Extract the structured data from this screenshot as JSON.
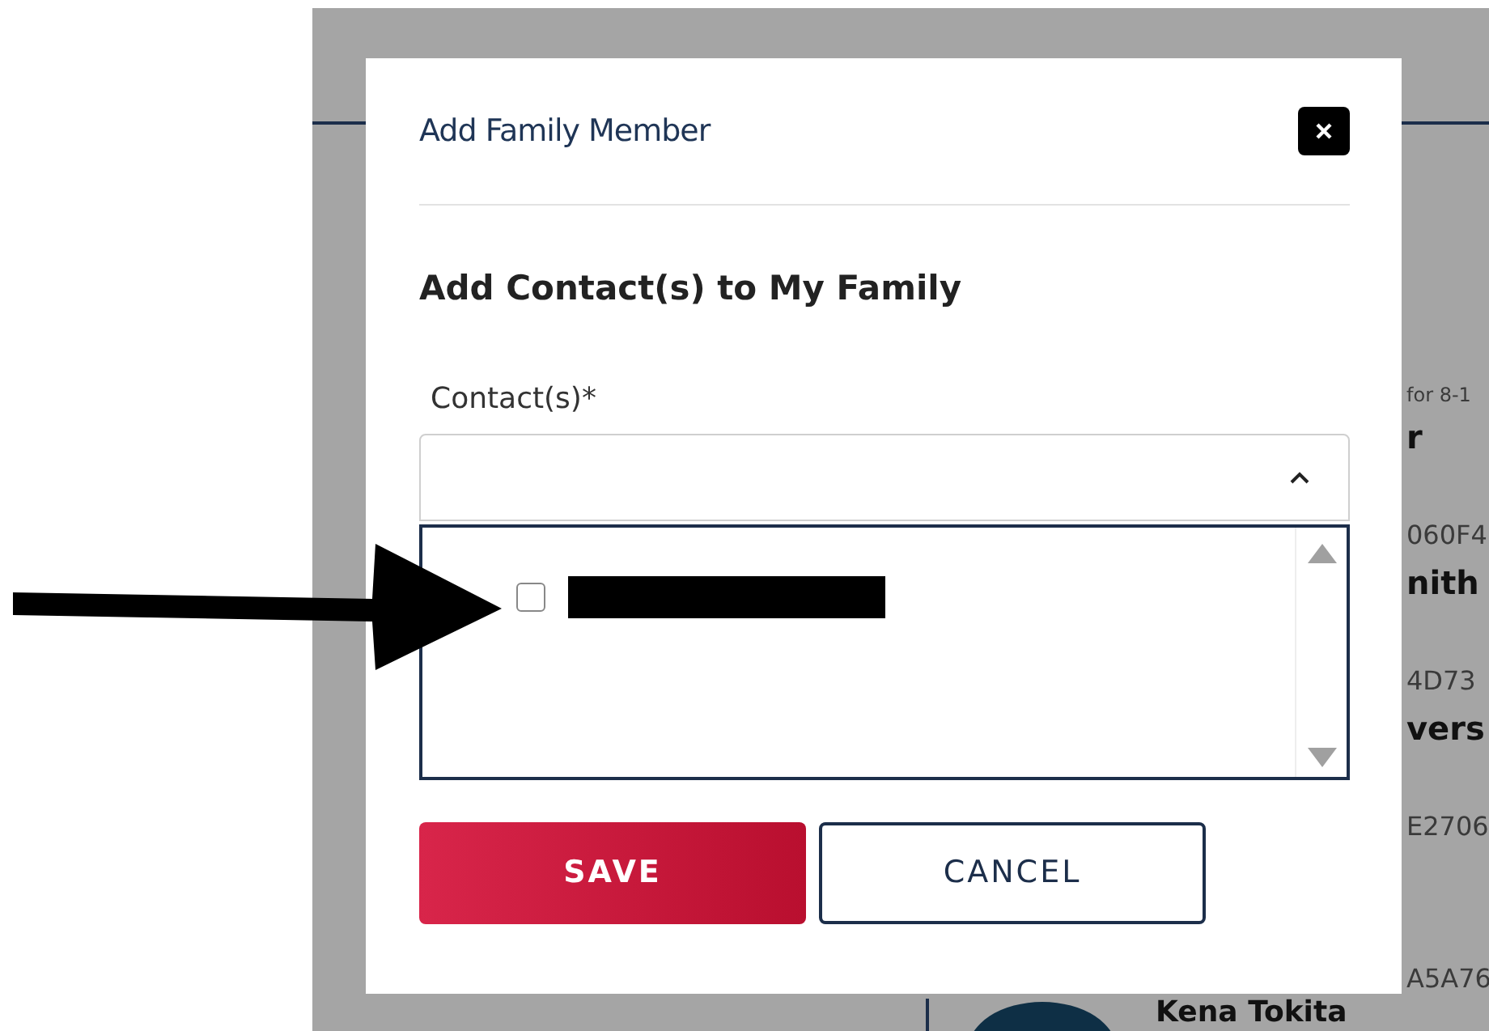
{
  "background": {
    "side_texts": [
      {
        "text": "for 8-1",
        "kind": "note"
      },
      {
        "text": "r",
        "kind": "name"
      },
      {
        "text": "060F4",
        "kind": "code"
      },
      {
        "text": "nith",
        "kind": "name"
      },
      {
        "text": "4D73",
        "kind": "code"
      },
      {
        "text": "vers",
        "kind": "name"
      },
      {
        "text": "E2706",
        "kind": "code"
      },
      {
        "text": "A5A76",
        "kind": "code"
      }
    ],
    "bottom_name": "Kena Tokita"
  },
  "modal": {
    "title": "Add Family Member",
    "heading": "Add Contact(s) to My Family",
    "field": {
      "label": "Contact(s)*",
      "expanded": true,
      "options": [
        {
          "checked": false,
          "redacted": true
        }
      ]
    },
    "buttons": [
      {
        "label": "SAVE",
        "kind": "primary"
      },
      {
        "label": "CANCEL",
        "kind": "secondary"
      }
    ]
  }
}
